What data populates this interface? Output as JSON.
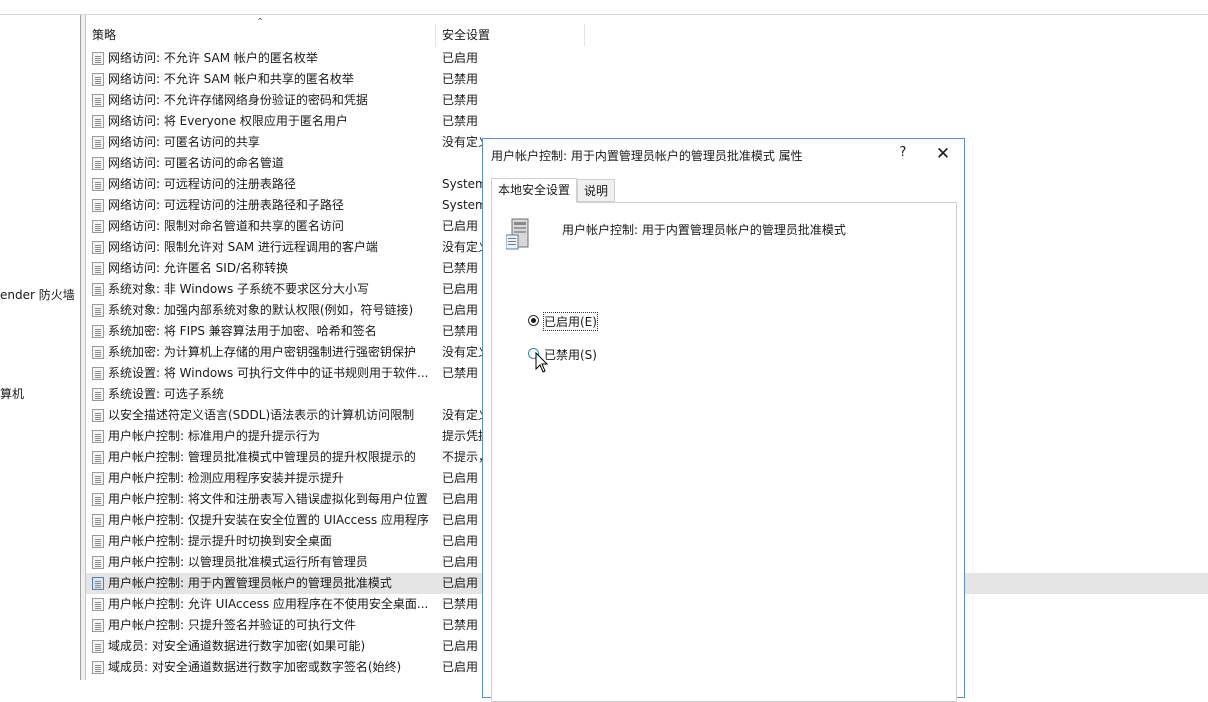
{
  "left_pane": {
    "items": [
      "ender 防火墙",
      "算机"
    ]
  },
  "list": {
    "headers": {
      "policy": "策略",
      "setting": "安全设置"
    },
    "rows": [
      {
        "policy": "网络访问: 不允许 SAM 帐户的匿名枚举",
        "setting": "已启用"
      },
      {
        "policy": "网络访问: 不允许 SAM 帐户和共享的匿名枚举",
        "setting": "已禁用"
      },
      {
        "policy": "网络访问: 不允许存储网络身份验证的密码和凭据",
        "setting": "已禁用"
      },
      {
        "policy": "网络访问: 将 Everyone 权限应用于匿名用户",
        "setting": "已禁用"
      },
      {
        "policy": "网络访问: 可匿名访问的共享",
        "setting": "没有定义"
      },
      {
        "policy": "网络访问: 可匿名访问的命名管道",
        "setting": ""
      },
      {
        "policy": "网络访问: 可远程访问的注册表路径",
        "setting": "System"
      },
      {
        "policy": "网络访问: 可远程访问的注册表路径和子路径",
        "setting": "System"
      },
      {
        "policy": "网络访问: 限制对命名管道和共享的匿名访问",
        "setting": "已启用"
      },
      {
        "policy": "网络访问: 限制允许对 SAM 进行远程调用的客户端",
        "setting": "没有定义"
      },
      {
        "policy": "网络访问: 允许匿名 SID/名称转换",
        "setting": "已禁用"
      },
      {
        "policy": "系统对象: 非 Windows 子系统不要求区分大小写",
        "setting": "已启用"
      },
      {
        "policy": "系统对象: 加强内部系统对象的默认权限(例如，符号链接)",
        "setting": "已启用"
      },
      {
        "policy": "系统加密: 将 FIPS 兼容算法用于加密、哈希和签名",
        "setting": "已禁用"
      },
      {
        "policy": "系统加密: 为计算机上存储的用户密钥强制进行强密钥保护",
        "setting": "没有定义"
      },
      {
        "policy": "系统设置: 将 Windows 可执行文件中的证书规则用于软件...",
        "setting": "已禁用"
      },
      {
        "policy": "系统设置: 可选子系统",
        "setting": ""
      },
      {
        "policy": "以安全描述符定义语言(SDDL)语法表示的计算机访问限制",
        "setting": "没有定义"
      },
      {
        "policy": "用户帐户控制: 标准用户的提升提示行为",
        "setting": "提示凭据"
      },
      {
        "policy": "用户帐户控制: 管理员批准模式中管理员的提升权限提示的",
        "setting": "不提示，"
      },
      {
        "policy": "用户帐户控制: 检测应用程序安装并提示提升",
        "setting": "已启用"
      },
      {
        "policy": "用户帐户控制: 将文件和注册表写入错误虚拟化到每用户位置",
        "setting": "已启用"
      },
      {
        "policy": "用户帐户控制: 仅提升安装在安全位置的 UIAccess 应用程序",
        "setting": "已启用"
      },
      {
        "policy": "用户帐户控制: 提示提升时切换到安全桌面",
        "setting": "已启用"
      },
      {
        "policy": "用户帐户控制: 以管理员批准模式运行所有管理员",
        "setting": "已启用"
      },
      {
        "policy": "用户帐户控制: 用于内置管理员帐户的管理员批准模式",
        "setting": "已启用",
        "selected": true
      },
      {
        "policy": "用户帐户控制: 允许 UIAccess 应用程序在不使用安全桌面...",
        "setting": "已禁用"
      },
      {
        "policy": "用户帐户控制: 只提升签名并验证的可执行文件",
        "setting": "已禁用"
      },
      {
        "policy": "域成员: 对安全通道数据进行数字加密(如果可能)",
        "setting": "已启用"
      },
      {
        "policy": "域成员: 对安全通道数据进行数字加密或数字签名(始终)",
        "setting": "已启用"
      }
    ]
  },
  "dialog": {
    "title": "用户帐户控制: 用于内置管理员帐户的管理员批准模式 属性",
    "help_label": "?",
    "close_label": "✕",
    "tabs": [
      "本地安全设置",
      "说明"
    ],
    "policy_name": "用户帐户控制: 用于内置管理员帐户的管理员批准模式",
    "options": [
      {
        "label": "已启用(E)",
        "checked": true
      },
      {
        "label": "已禁用(S)",
        "checked": false
      }
    ]
  },
  "colors": {
    "arrow": "#d4121b",
    "dialog_border": "#5b8fc7",
    "selected_row": "#e5e5e5"
  }
}
